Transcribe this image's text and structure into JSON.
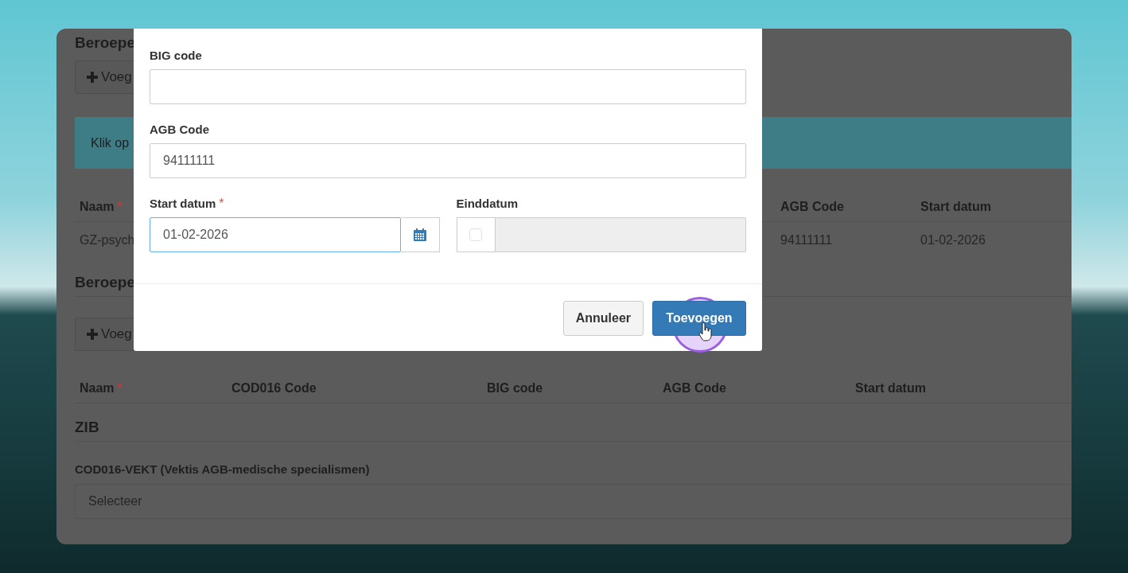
{
  "page": {
    "heading_1": "Beroepe",
    "add_button_1": "Voeg",
    "info_alert": "Klik op",
    "table_1": {
      "columns": [
        {
          "label": "Naam",
          "required_marker": "*"
        },
        {
          "label": "AGB Code"
        },
        {
          "label": "Start datum"
        }
      ],
      "rows": [
        [
          "GZ-psych",
          "94111111",
          "01-02-2026"
        ]
      ]
    },
    "heading_2": "Beroepe",
    "add_button_2": "Voeg",
    "table_2": {
      "columns": [
        {
          "label": "Naam",
          "required_marker": "*"
        },
        {
          "label": "COD016 Code"
        },
        {
          "label": "BIG code"
        },
        {
          "label": "AGB Code"
        },
        {
          "label": "Start datum"
        }
      ]
    },
    "zib_heading": "ZIB",
    "select_label": "COD016-VEKT (Vektis AGB-medische specialismen)",
    "select_placeholder": "Selecteer"
  },
  "modal": {
    "fields": [
      {
        "kind": "text",
        "label": "BIG code"
      },
      {
        "kind": "text",
        "label": "AGB Code",
        "value": "94111111"
      },
      {
        "kind": "date",
        "label": "Start datum",
        "required_marker": "*",
        "value": "01-02-2026",
        "focused": true
      },
      {
        "kind": "optional-date",
        "label": "Einddatum",
        "checked": false,
        "disabled": true
      }
    ],
    "buttons": [
      {
        "label": "Annuleer",
        "kind": "secondary"
      },
      {
        "label": "Toevoegen",
        "kind": "primary"
      }
    ]
  }
}
